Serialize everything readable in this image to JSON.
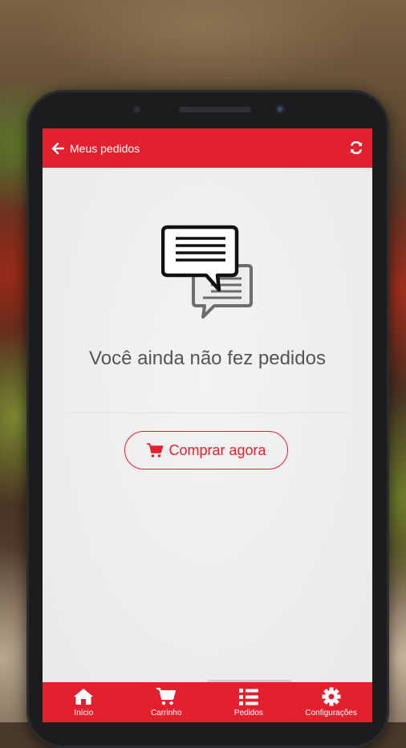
{
  "appbar": {
    "title": "Meus pedidos",
    "back_icon": "arrow-left-icon",
    "refresh_icon": "refresh-icon"
  },
  "empty_state": {
    "icon": "chat-bubbles-icon",
    "message": "Você ainda não fez pedidos"
  },
  "cta": {
    "icon": "cart-icon",
    "label": "Comprar agora"
  },
  "tabs": [
    {
      "label": "Início",
      "icon": "home-icon"
    },
    {
      "label": "Carrinho",
      "icon": "cart-icon"
    },
    {
      "label": "Pedidos",
      "icon": "list-icon",
      "active": true
    },
    {
      "label": "Configurações",
      "icon": "gear-icon"
    }
  ],
  "colors": {
    "brand": "#e3202e",
    "background": "#efefef",
    "text": "#555555"
  }
}
